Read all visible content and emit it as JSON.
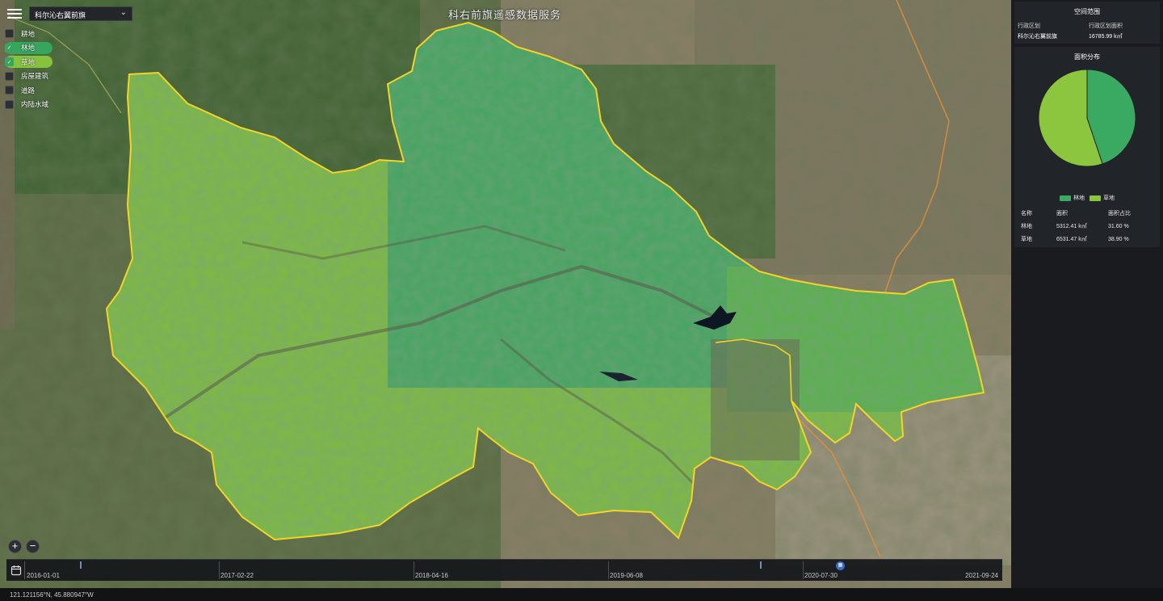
{
  "map": {
    "title": "科右前旗遥感数据服务",
    "region_selector": "科尔沁右翼前旗"
  },
  "layers": [
    {
      "label": "耕地",
      "checked": false,
      "state": "off"
    },
    {
      "label": "林地",
      "checked": true,
      "state": "forest"
    },
    {
      "label": "草地",
      "checked": true,
      "state": "grass"
    },
    {
      "label": "房屋建筑",
      "checked": false,
      "state": "off"
    },
    {
      "label": "道路",
      "checked": false,
      "state": "off"
    },
    {
      "label": "内陆水域",
      "checked": false,
      "state": "off"
    }
  ],
  "zoom": {
    "in": "+",
    "out": "−"
  },
  "timeline": {
    "ticks": [
      "2016-01-01",
      "2017-02-22",
      "2018-04-16",
      "2019-06-08",
      "2020-07-30",
      "2021-09-24"
    ]
  },
  "status": {
    "coordinates": "121.121156°N, 45.880947°W"
  },
  "panel": {
    "spatial": {
      "title": "空间范围",
      "col1_header": "行政区划",
      "col2_header": "行政区划面积",
      "region": "科尔沁右翼前旗",
      "area": "16785.99 k㎡"
    },
    "distribution": {
      "title": "面积分布",
      "headers": [
        "名称",
        "面积",
        "面积占比"
      ],
      "rows": [
        {
          "name": "林地",
          "area": "5312.41 k㎡",
          "pct": "31.60 %"
        },
        {
          "name": "草地",
          "area": "6531.47 k㎡",
          "pct": "38.90 %"
        }
      ]
    }
  },
  "chart_data": {
    "type": "pie",
    "categories": [
      "林地",
      "草地"
    ],
    "values": [
      5312.41,
      6531.47
    ],
    "legend_position": "bottom",
    "colors": [
      "#3aaa62",
      "#8cc63f"
    ]
  },
  "colors": {
    "forest": "#3aaa62",
    "grass": "#8cc63f",
    "boundary": "#f5d327"
  }
}
